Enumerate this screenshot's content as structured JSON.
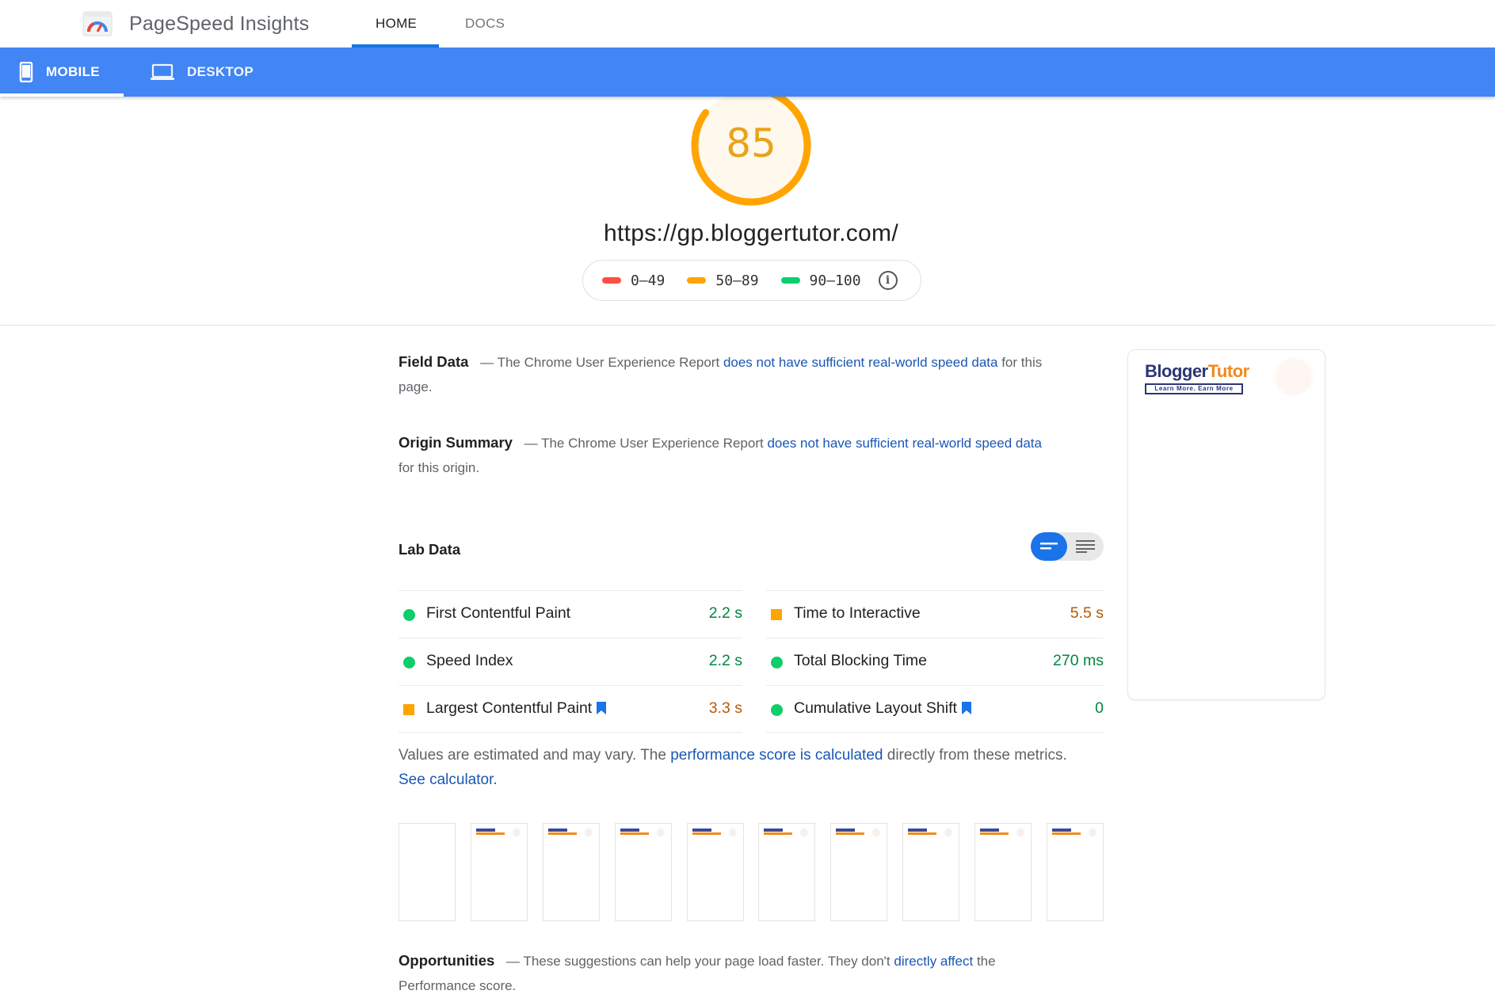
{
  "app": {
    "title": "PageSpeed Insights",
    "nav": [
      {
        "label": "HOME",
        "active": true
      },
      {
        "label": "DOCS",
        "active": false
      }
    ]
  },
  "device_tabs": [
    {
      "label": "MOBILE",
      "active": true,
      "icon": "phone-icon"
    },
    {
      "label": "DESKTOP",
      "active": false,
      "icon": "laptop-icon"
    }
  ],
  "score": {
    "value": "85",
    "fraction": 0.85,
    "color": "#ffa400"
  },
  "url": "https://gp.bloggertutor.com/",
  "legend": [
    {
      "range": "0–49",
      "color": "#ff4e42"
    },
    {
      "range": "50–89",
      "color": "#ffa400"
    },
    {
      "range": "90–100",
      "color": "#0cce6b"
    }
  ],
  "field_data": {
    "title": "Field Data",
    "dash": "—",
    "prefix": "The Chrome User Experience Report",
    "link": "does not have sufficient real-world speed data",
    "suffix": "for this page."
  },
  "origin_summary": {
    "title": "Origin Summary",
    "dash": "—",
    "prefix": "The Chrome User Experience Report",
    "link": "does not have sufficient real-world speed data",
    "suffix": "for this origin."
  },
  "lab_data": {
    "title": "Lab Data",
    "left_metrics": [
      {
        "name": "First Contentful Paint",
        "value": "2.2 s",
        "status": "pass",
        "bookmark": false
      },
      {
        "name": "Speed Index",
        "value": "2.2 s",
        "status": "pass",
        "bookmark": false
      },
      {
        "name": "Largest Contentful Paint",
        "value": "3.3 s",
        "status": "average",
        "bookmark": true
      }
    ],
    "right_metrics": [
      {
        "name": "Time to Interactive",
        "value": "5.5 s",
        "status": "average",
        "bookmark": false
      },
      {
        "name": "Total Blocking Time",
        "value": "270 ms",
        "status": "pass",
        "bookmark": false
      },
      {
        "name": "Cumulative Layout Shift",
        "value": "0",
        "status": "pass",
        "bookmark": true
      }
    ]
  },
  "estimate": {
    "prefix": "Values are estimated and may vary. The",
    "link1": "performance score is calculated",
    "middle": "directly from these metrics.",
    "link2": "See calculator."
  },
  "filmstrip": {
    "frames": 10
  },
  "opportunities": {
    "title": "Opportunities",
    "dash": "—",
    "prefix": "These suggestions can help your page load faster. They don't",
    "link": "directly affect",
    "suffix": "the Performance score."
  },
  "preview": {
    "brand_a": "Blogger",
    "brand_b": "Tutor",
    "tagline": "Learn More. Earn More"
  }
}
